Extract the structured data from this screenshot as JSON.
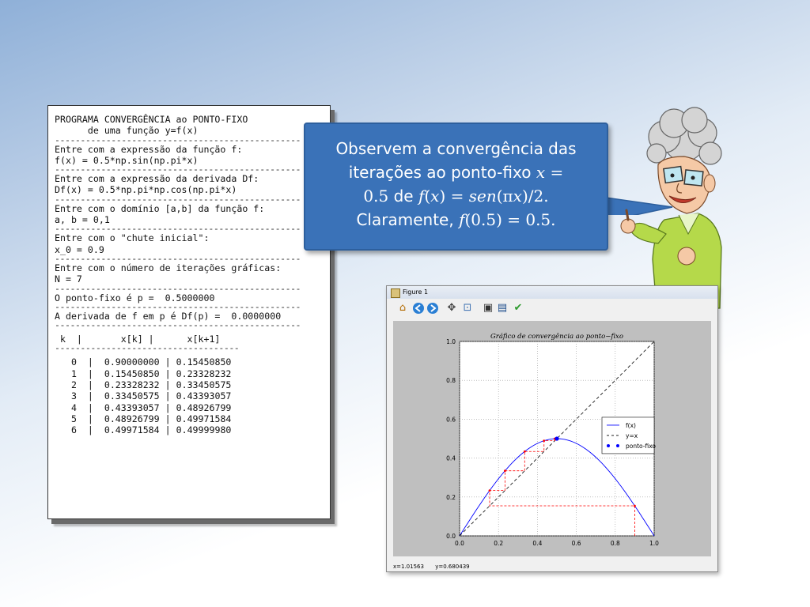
{
  "console": {
    "title_line1": "PROGRAMA CONVERGÊNCIA ao PONTO-FIXO",
    "title_line2": "      de uma função y=f(x)",
    "separator": "------------------------------------------------",
    "prompt_f": "Entre com a expressão da função f:",
    "input_f": "f(x) = 0.5*np.sin(np.pi*x)",
    "prompt_df": "Entre com a expressão da derivada Df:",
    "input_df": "Df(x) = 0.5*np.pi*np.cos(np.pi*x)",
    "prompt_domain": "Entre com o domínio [a,b] da função f:",
    "input_domain": "a, b = 0,1",
    "prompt_guess": "Entre com o \"chute inicial\":",
    "input_guess": "x_0 = 0.9",
    "prompt_iter": "Entre com o número de iterações gráficas:",
    "input_iter": "N = 7",
    "result_p": "O ponto-fixo é p =  0.5000000",
    "result_df": "A derivada de f em p é Df(p) =  0.0000000",
    "table_header": " k  |       x[k] |      x[k+1]",
    "table_separator": "------------------------------------",
    "rows": [
      {
        "k": "0",
        "xk": "0.90000000",
        "xk1": "0.15450850"
      },
      {
        "k": "1",
        "xk": "0.15450850",
        "xk1": "0.23328232"
      },
      {
        "k": "2",
        "xk": "0.23328232",
        "xk1": "0.33450575"
      },
      {
        "k": "3",
        "xk": "0.33450575",
        "xk1": "0.43393057"
      },
      {
        "k": "4",
        "xk": "0.43393057",
        "xk1": "0.48926799"
      },
      {
        "k": "5",
        "xk": "0.48926799",
        "xk1": "0.49971584"
      },
      {
        "k": "6",
        "xk": "0.49971584",
        "xk1": "0.49999980"
      }
    ]
  },
  "bubble": {
    "l1": "Observem a convergência das",
    "l2_a": "iterações ao ponto-fixo ",
    "l2_x": "x",
    "l2_b": " =",
    "l3_a": "0.5",
    "l3_b": " de ",
    "l3_c": "f",
    "l3_d": "(",
    "l3_e": "x",
    "l3_f": ") = ",
    "l3_g": "sen",
    "l3_h": "(π",
    "l3_i": "x",
    "l3_j": ")/2.",
    "l4_a": "Claramente, ",
    "l4_b": "f",
    "l4_c": "(0.5) = 0.5.",
    "color": "#3a72b8"
  },
  "figure": {
    "window_title": "Figure 1",
    "toolbar_icons": [
      "home-icon",
      "back-icon",
      "forward-icon",
      "pan-icon",
      "zoom-icon",
      "subplots-icon",
      "save-icon",
      "check-icon"
    ],
    "status_x": "x=1.01563",
    "status_y": "y=0.680439"
  },
  "chart_data": {
    "type": "line",
    "title": "Gráfico de convergência ao ponto−fixo",
    "xlim": [
      0,
      1
    ],
    "ylim": [
      0,
      1
    ],
    "xticks": [
      "0.0",
      "0.2",
      "0.4",
      "0.6",
      "0.8",
      "1.0"
    ],
    "yticks": [
      "0.0",
      "0.2",
      "0.4",
      "0.6",
      "0.8",
      "1.0"
    ],
    "grid": true,
    "legend_position": "center-right",
    "legend": [
      "f(x)",
      "y=x",
      "ponto-fixo"
    ],
    "series": [
      {
        "name": "f(x)",
        "function": "0.5*sin(pi*x)",
        "color": "#0000ff",
        "style": "solid"
      },
      {
        "name": "y=x",
        "function": "x",
        "color": "#000000",
        "style": "dashed"
      },
      {
        "name": "ponto-fixo",
        "x": [
          0.5
        ],
        "y": [
          0.5
        ],
        "color": "#0000ff",
        "style": "marker"
      }
    ],
    "iterates": [
      0.9,
      0.1545085,
      0.23328232,
      0.33450575,
      0.43393057,
      0.48926799,
      0.49971584,
      0.4999998
    ],
    "iterate_color": "#ff0000"
  }
}
